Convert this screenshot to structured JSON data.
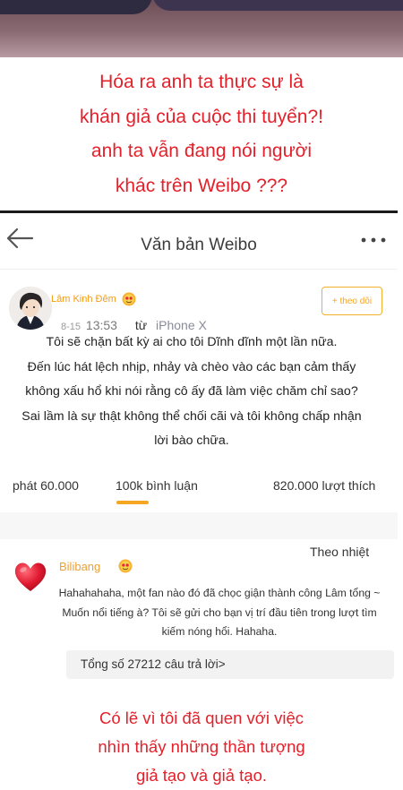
{
  "captions": {
    "top": [
      "Hóa ra anh ta thực sự là",
      "khán giả của cuộc thi tuyển?!",
      "anh ta vẫn đang nói người",
      "khác trên Weibo ???"
    ],
    "bottom": [
      "Có lẽ vì tôi đã quen với việc",
      "nhìn thấy những thần tượng",
      "giả tạo và giả tạo."
    ]
  },
  "navbar": {
    "title": "Văn bản Weibo",
    "back_icon": "arrow-left-icon",
    "more_icon": "more-dots-icon"
  },
  "post": {
    "username": "Lâm Kinh Đêm",
    "badge_icon": "vip-badge-icon",
    "follow_label": "+ theo dõi",
    "date": "8-15",
    "time": "13:53",
    "from_label": "từ",
    "device": "iPhone X",
    "text_lines": [
      "Tôi sẽ chặn bất kỳ ai cho tôi Dĩnh dĩnh một lần nữa.",
      "Đến lúc hát lệch nhịp, nhảy và chèo vào các bạn cảm thấy",
      "không xấu hổ khi nói rằng cô ấy đã làm việc chăm chỉ sao?",
      "Sai lầm là sự thật không thể chối cãi và tôi không chấp nhận",
      "lời bào chữa."
    ]
  },
  "stats": {
    "shares": "phát 60.000",
    "comments": "100k bình luận",
    "likes": "820.000 lượt thích"
  },
  "comments": {
    "sort_label": "Theo nhiệt",
    "item": {
      "username": "Bilibang",
      "avatar_icon": "heart-icon",
      "text_lines": [
        "Hahahahaha, một fan nào đó đã chọc giận thành công Lâm tổng ~",
        "Muốn nổi tiếng à? Tôi sẽ gửi cho bạn vị trí đầu tiên trong lượt tìm",
        "kiếm nóng hổi. Hahaha."
      ],
      "replies_label": "Tổng số 27212 câu trả lời>"
    }
  },
  "colors": {
    "caption_red": "#e4202a",
    "accent_orange": "#f5a623",
    "username_orange": "#f59b15"
  }
}
